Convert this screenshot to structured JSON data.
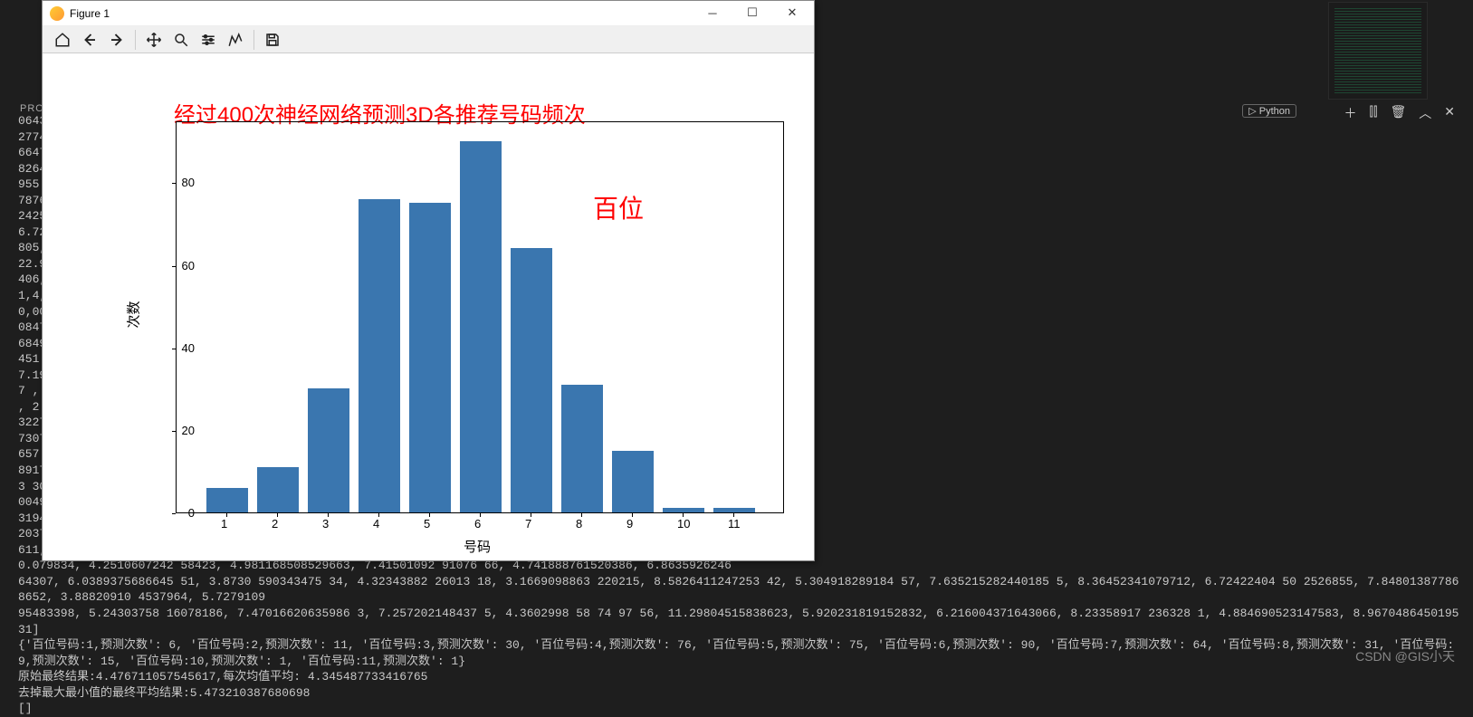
{
  "ide": {
    "problems_label": "PRO",
    "python_badge": "Python",
    "terminal_text": "064331, 4.44949197769165, 6.980476856231689 5, 4.891016483306885, 7.236514568328857, 1.7590293884\n27748461376 95, 3.5778263092041, 5.861629962921143, 5.805952072143555, 3.0151777267456055, 6.79211\n66474706907272338867, 5.946206092834473, 4.110585927963257, 8.398144721984863, 3.1458318233489 99, 4\n8264, 9.129207611083984, 7.967223167419434, 7.472574234008789, 4.898161888122559, 5.7834634780883 79\n955 28174, 3.80413269 96644307, 5.5013179779052 73, 7.658638954162598, 3.4905889034271 24, 4.2608268260\n78766224822998, 5.192361831665039, 7.067321777343 75, 4.877849674224 85, 4.4054839611053 47, 2.7077897\n2425107383728027, 7.4431099891662 6, 5.246265888214111, 3.2453151333 92334, 5.517045974731445, 3.868\n6.722984790802002, 6.165707111358643, 6.022866725921631, 7.528797626495361, 6.052576065063477,\n805, 4.550178527832031, 6.404738903045654, 4.0252571105 95703, 2.51222503 185272 2, 8.2359089851379\n22.9, 4.703215599060059, 4.544022083282471, 5.62187576 29 39453, 4.3079085350036 62, 6.960164546966553\n406, 5.053076744079 59, 4.828491687774658, 2.177882 7419281, 4.582110404968262, 5.2134861946105 96\n1,4, 4.65693259 2391968, 6.652653217315674, 4.165776014328003, 4.141163 78 974914 55, 5.1450166702270 5\n0,008, 7.525193214416504, 4.482622146606445, 6.807358264923096, 6.061794757843018, 4.1094069480896\n0847432, 7.182092189788818, 5.821644783020019 5, 5.860076427459717, 4.1443552970886 23, 4.11419391632\n684939331055, 5.24330902 48352051, 8.577 5146484375, 6.039258480072021 5, 6.438099384307861, 2.652 24170\n451 83961963653564, 6.595163822174072, 2.981010874313354 5, 4.5169315338134 77, 3.9119710922241 21, 6.4\n7.192176818847656, 5.675520896911621, 5. 96281414031982, 6.89296 2932586 67, 6.752470970153809, 2\n7 , 4.985865116119385, 4.463071107864 38, 6.836350917816162, 5.670343399047852, 5.600384235382 08, 6\n, 2.982520580291 748, 8.059305667877197, 6.456167221069336, 4.264124 89 5858765, 2.2217898 598464966\n32275, 9.0 75817108154297, 2.5789318084716797, 6.86180162429 8096, 7.334919452667236, 2.8646180629\n73075 7644653, 6.385758876800537, 6.552841186523437 5, 4.929964 596063 232, 5.924133977618408, 5.500449\n657 4217004776001, 3.660571813583374, 3.1729071140289307, 4.271795272827148 4, 5.69 4241046905518, 8.09\n8917.689940929 41284 2, 3.621466398 2391357, 4.935344219207764, 4.32551 5098571 78, 6.0154113769 53125,\n3 303, 3.2414109706878 66, 5.127348899841309, 4.238167524337768 6, 3.842789649 96337 9, 1.160050 5835 95\n00496804199, 8.789653301239014, 5.48132848739624, 3.2241833209991455, 3.260350048843384, 5.535029411\n31948938751221, 4.72156 21471405 03, 7.178143978118 8965, 6.4257448 348 236084, 7.932142734527 588, 4.1909\n2037744124412536 621, 5.202163219451904, 5.9134616851806 64, 7.402122783660889, 5.856361865 97314 5, 5\n611, 5.444449901 5808105, 4.503388643264770 5, 6.263046 5402603 9, 9.5508127212 52441, 5.2226657390 9448\n0.079834, 4.2510607242 58423, 4.981168508529663, 7.41501092 91076 66, 4.741888761520386, 6.8635926246\n64307, 6.0389375686645 51, 3.8730 590343475 34, 4.32343882 26013 18, 3.1669098863 220215, 8.5826411247253 42, 5.304918289184 57, 7.635215282440185 5, 8.36452341079712, 6.72422404 50 2526855, 7.848013877868652, 3.88820910 4537964, 5.7279109\n95483398, 5.24303758 16078186, 7.47016620635986 3, 7.257202148437 5, 4.3602998 58 74 97 56, 11.29804515838623, 5.920231819152832, 6.216004371643066, 8.23358917 236328 1, 4.884690523147583, 8.967048645019531]\n{'百位号码:1,预测次数': 6, '百位号码:2,预测次数': 11, '百位号码:3,预测次数': 30, '百位号码:4,预测次数': 76, '百位号码:5,预测次数': 75, '百位号码:6,预测次数': 90, '百位号码:7,预测次数': 64, '百位号码:8,预测次数': 31, '百位号码:9,预测次数': 15, '百位号码:10,预测次数': 1, '百位号码:11,预测次数': 1}\n原始最终结果:4.476711057545617,每次均值平均: 4.345487733416765\n去掉最大最小值的最终平均结果:5.473210387680698\n[]"
  },
  "window": {
    "title": "Figure 1"
  },
  "chart_data": {
    "type": "bar",
    "title": "经过400次神经网络预测3D各推荐号码频次",
    "xlabel": "号码",
    "ylabel": "次数",
    "categories": [
      "1",
      "2",
      "3",
      "4",
      "5",
      "6",
      "7",
      "8",
      "9",
      "10",
      "11"
    ],
    "values": [
      6,
      11,
      30,
      76,
      75,
      90,
      64,
      31,
      15,
      1,
      1
    ],
    "yticks": [
      0,
      20,
      40,
      60,
      80
    ],
    "ylim": [
      0,
      95
    ],
    "annotation": "百位"
  },
  "watermark": "CSDN @GIS小天"
}
